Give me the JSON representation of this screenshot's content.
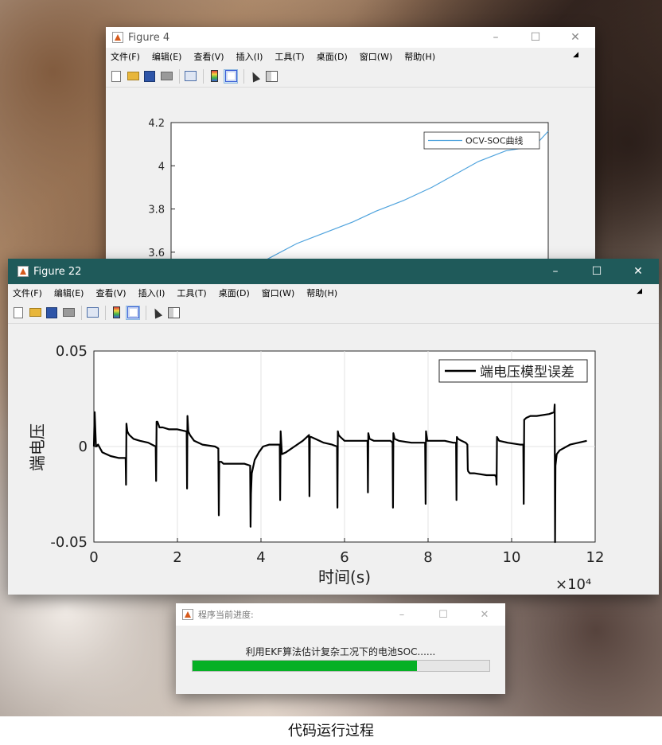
{
  "fig4": {
    "title": "Figure 4",
    "window_controls": [
      "–",
      "☐",
      "✕"
    ],
    "menu": [
      "文件(F)",
      "编辑(E)",
      "查看(V)",
      "插入(I)",
      "工具(T)",
      "桌面(D)",
      "窗口(W)",
      "帮助(H)"
    ],
    "legend": "OCV-SOC曲线",
    "y_ticks": [
      "4.2",
      "4",
      "3.8",
      "3.6"
    ]
  },
  "fig22": {
    "title": "Figure 22",
    "window_controls": [
      "–",
      "☐",
      "✕"
    ],
    "menu": [
      "文件(F)",
      "编辑(E)",
      "查看(V)",
      "插入(I)",
      "工具(T)",
      "桌面(D)",
      "窗口(W)",
      "帮助(H)"
    ]
  },
  "toolbar_icons": [
    "new-file-icon",
    "open-folder-icon",
    "save-icon",
    "print-icon",
    "link-plot-icon",
    "colorbar-icon",
    "legend-icon",
    "pointer-icon",
    "property-panel-icon"
  ],
  "progress": {
    "title": "程序当前进度:",
    "message": "利用EKF算法估计复杂工况下的电池SOC......",
    "value": 0.755,
    "color": "#06b025",
    "window_controls": [
      "–",
      "☐",
      "✕"
    ]
  },
  "caption": "代码运行过程",
  "chart_data": [
    {
      "type": "line",
      "series": [
        {
          "name": "OCV-SOC曲线",
          "color": "#4fa3dd",
          "x": [
            0.17,
            0.2,
            0.27,
            0.33,
            0.39,
            0.44,
            0.5,
            0.56,
            0.61,
            0.66,
            0.72,
            0.78,
            0.81
          ],
          "values": [
            3.52,
            3.56,
            3.64,
            3.69,
            3.74,
            3.79,
            3.84,
            3.9,
            3.96,
            4.02,
            4.07,
            4.09,
            4.16
          ]
        }
      ],
      "ylim": [
        3.5,
        4.2
      ],
      "y_ticks": [
        3.6,
        3.8,
        4.0,
        4.2
      ],
      "xlim": [
        0,
        0.81
      ]
    },
    {
      "type": "line",
      "ylabel": "端电压",
      "xlabel": "时间(s)",
      "x_multiplier": "×10⁴",
      "xlim": [
        0,
        12
      ],
      "ylim": [
        -0.05,
        0.05
      ],
      "x_ticks": [
        "0",
        "2",
        "4",
        "6",
        "8",
        "10",
        "12"
      ],
      "y_ticks": [
        "0.05",
        "0",
        "-0.05"
      ],
      "grid": true,
      "legend_position": "top-right",
      "series": [
        {
          "name": "端电压模型误差",
          "color": "#000000",
          "x": [
            0.0,
            0.02,
            0.05,
            0.1,
            0.2,
            0.4,
            0.6,
            0.76,
            0.77,
            0.78,
            0.8,
            0.82,
            0.85,
            0.95,
            1.1,
            1.3,
            1.48,
            1.49,
            1.5,
            1.52,
            1.54,
            1.57,
            1.65,
            1.8,
            2.0,
            2.2,
            2.22,
            2.23,
            2.24,
            2.26,
            2.28,
            2.3,
            2.4,
            2.6,
            2.9,
            2.98,
            2.99,
            3.0,
            3.02,
            3.05,
            3.1,
            3.3,
            3.6,
            3.74,
            3.75,
            3.76,
            3.78,
            3.85,
            3.95,
            4.05,
            4.2,
            4.4,
            4.45,
            4.46,
            4.47,
            4.5,
            4.6,
            4.8,
            5.0,
            5.15,
            5.16,
            5.17,
            5.2,
            5.3,
            5.5,
            5.7,
            5.82,
            5.83,
            5.84,
            5.86,
            5.9,
            6.0,
            6.3,
            6.5,
            6.55,
            6.56,
            6.57,
            6.6,
            6.7,
            6.9,
            7.1,
            7.15,
            7.16,
            7.17,
            7.2,
            7.3,
            7.6,
            7.9,
            7.93,
            7.94,
            7.95,
            7.98,
            8.1,
            8.4,
            8.6,
            8.67,
            8.68,
            8.69,
            8.72,
            8.8,
            8.9,
            8.94,
            8.95,
            8.96,
            9.0,
            9.1,
            9.4,
            9.6,
            9.63,
            9.64,
            9.65,
            9.7,
            9.9,
            10.2,
            10.28,
            10.29,
            10.3,
            10.35,
            10.45,
            10.6,
            10.9,
            11.02,
            11.03,
            11.04,
            11.05,
            11.08,
            11.15,
            11.4,
            11.8
          ],
          "values": [
            0.0,
            0.018,
            -0.0,
            0.001,
            -0.003,
            -0.005,
            -0.006,
            -0.006,
            -0.02,
            0.012,
            0.008,
            0.007,
            0.006,
            0.004,
            0.003,
            0.002,
            0.0,
            -0.018,
            0.013,
            0.013,
            0.012,
            0.01,
            0.01,
            0.009,
            0.009,
            0.008,
            0.008,
            -0.022,
            0.016,
            0.008,
            0.007,
            0.006,
            0.003,
            0.001,
            0.0,
            -0.001,
            -0.036,
            -0.008,
            -0.008,
            -0.008,
            -0.009,
            -0.009,
            -0.009,
            -0.01,
            -0.042,
            -0.025,
            -0.014,
            -0.007,
            -0.003,
            0.0,
            0.001,
            0.001,
            0.001,
            -0.028,
            0.008,
            -0.004,
            -0.003,
            0.0,
            0.003,
            0.006,
            -0.026,
            0.005,
            0.005,
            0.004,
            0.002,
            0.001,
            0.0,
            -0.032,
            0.008,
            0.006,
            0.005,
            0.003,
            0.003,
            0.003,
            0.003,
            -0.024,
            0.007,
            0.004,
            0.003,
            0.003,
            0.003,
            0.002,
            -0.032,
            0.007,
            0.004,
            0.003,
            0.002,
            0.002,
            0.002,
            -0.03,
            0.008,
            0.003,
            0.003,
            0.003,
            0.002,
            0.002,
            -0.028,
            0.005,
            0.004,
            0.003,
            0.002,
            0.001,
            -0.012,
            -0.013,
            -0.014,
            -0.014,
            -0.015,
            -0.015,
            -0.016,
            -0.02,
            0.005,
            0.003,
            0.002,
            0.001,
            0.001,
            -0.03,
            0.014,
            0.015,
            0.016,
            0.016,
            0.017,
            0.018,
            0.022,
            -0.05,
            -0.01,
            -0.004,
            -0.002,
            0.001,
            0.003
          ]
        }
      ]
    }
  ]
}
